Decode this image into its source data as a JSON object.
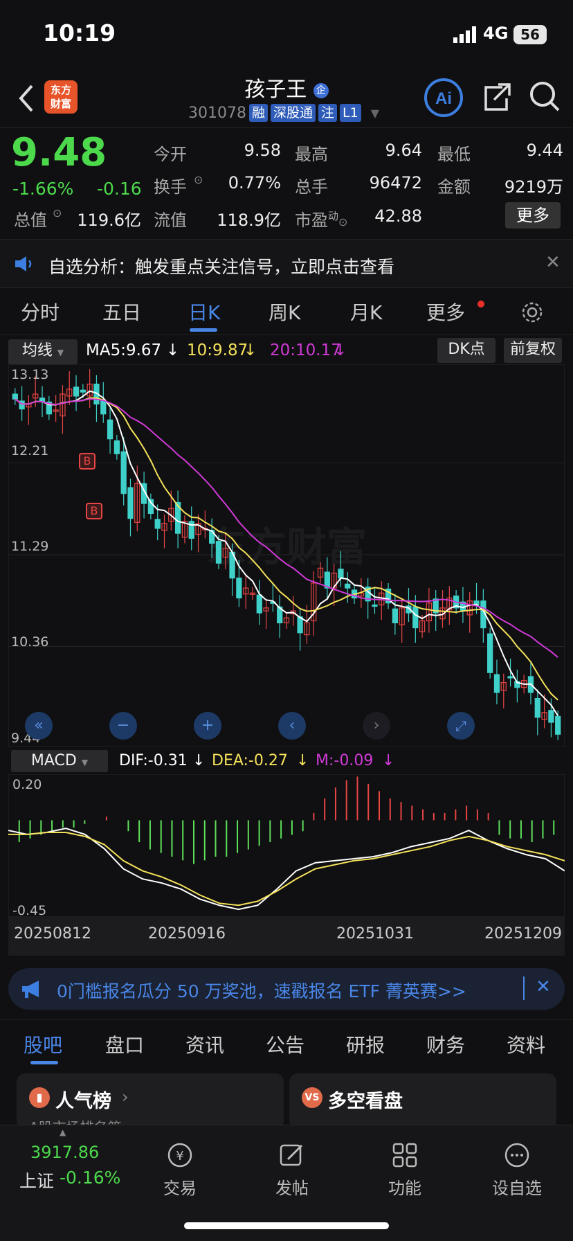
{
  "status_bar": {
    "time": "10:19",
    "network": "4G",
    "battery": "56"
  },
  "header": {
    "logo_text": "东方\n财富",
    "title": "孩子王",
    "code": "301078",
    "tags": [
      "融",
      "深股通",
      "注",
      "L1"
    ]
  },
  "quote": {
    "price": "9.48",
    "change_pct": "-1.66%",
    "change": "-0.16",
    "fields": {
      "open_label": "今开",
      "open": "9.58",
      "high_label": "最高",
      "high": "9.64",
      "low_label": "最低",
      "low": "9.44",
      "turnover_label": "换手",
      "turnover": "0.77%",
      "volume_label": "总手",
      "volume": "96472",
      "amount_label": "金额",
      "amount": "9219万",
      "mcap_label": "总值",
      "mcap": "119.6亿",
      "float_label": "流值",
      "float": "118.9亿",
      "pe_label": "市盈",
      "pe_sup": "动",
      "pe": "42.88"
    },
    "more_button": "更多"
  },
  "notice": {
    "text": "自选分析：触发重点关注信号，立即点击查看"
  },
  "period_tabs": [
    "分时",
    "五日",
    "日K",
    "周K",
    "月K",
    "更多"
  ],
  "active_period": "日K",
  "chart_toolbar": {
    "indicator": "均线",
    "ma5": "MA5:9.67",
    "ma10": "10:9.87",
    "ma20": "20:10.17",
    "dk_button": "DK点",
    "adjust_button": "前复权"
  },
  "macd_toolbar": {
    "indicator": "MACD",
    "dif": "DIF:-0.31",
    "dea": "DEA:-0.27",
    "m": "M:-0.09"
  },
  "chart_data": {
    "type": "candlestick",
    "price_ticks": [
      "13.13",
      "12.21",
      "11.29",
      "10.36",
      "9.44"
    ],
    "price_range": [
      9.44,
      13.13
    ],
    "macd_ticks": [
      "0.20",
      "-0.45"
    ],
    "macd_range": [
      -0.45,
      0.2
    ],
    "date_labels": [
      "20250812",
      "20250916",
      "20251031",
      "20251209"
    ],
    "buy_markers": [
      "B",
      "B"
    ],
    "colors": {
      "up": "#e84545",
      "down": "#3fd1c9",
      "ma5": "#ffffff",
      "ma10": "#f4e15a",
      "ma20": "#d03ad6"
    },
    "close": [
      12.85,
      12.75,
      12.8,
      12.9,
      12.82,
      12.7,
      12.74,
      12.9,
      12.95,
      12.88,
      12.92,
      13.0,
      12.8,
      12.7,
      12.45,
      12.3,
      11.9,
      11.65,
      12.0,
      11.8,
      11.7,
      11.55,
      11.6,
      11.75,
      11.5,
      11.62,
      11.45,
      11.6,
      11.55,
      11.4,
      11.2,
      11.35,
      11.05,
      10.85,
      10.95,
      10.9,
      10.7,
      10.75,
      10.8,
      10.6,
      10.65,
      10.72,
      10.5,
      10.6,
      11.0,
      11.15,
      10.95,
      11.1,
      11.05,
      10.95,
      10.85,
      10.9,
      10.82,
      10.78,
      10.9,
      10.8,
      10.6,
      10.75,
      10.7,
      10.55,
      10.62,
      10.8,
      10.7,
      10.75,
      10.85,
      10.75,
      10.72,
      10.82,
      10.78,
      10.55,
      10.1,
      9.9,
      10.0,
      10.05,
      9.95,
      10.02,
      9.9,
      9.65,
      9.7,
      9.6,
      9.48
    ],
    "macd_hist": [
      -0.06,
      -0.05,
      -0.04,
      -0.03,
      -0.02,
      -0.02,
      -0.01,
      0.0,
      0.01,
      0.0,
      -0.03,
      -0.06,
      -0.08,
      -0.09,
      -0.1,
      -0.11,
      -0.12,
      -0.11,
      -0.1,
      -0.1,
      -0.09,
      -0.08,
      -0.07,
      -0.06,
      -0.05,
      -0.04,
      -0.03,
      0.02,
      0.06,
      0.09,
      0.11,
      0.12,
      0.1,
      0.08,
      0.06,
      0.05,
      0.04,
      0.03,
      0.02,
      0.02,
      0.03,
      0.04,
      0.03,
      0.02,
      -0.04,
      -0.05,
      -0.05,
      -0.06,
      -0.05,
      -0.04
    ],
    "dif": [
      -0.05,
      -0.07,
      -0.06,
      -0.04,
      -0.07,
      -0.14,
      -0.24,
      -0.29,
      -0.31,
      -0.34,
      -0.39,
      -0.42,
      -0.44,
      -0.42,
      -0.34,
      -0.25,
      -0.21,
      -0.2,
      -0.19,
      -0.18,
      -0.16,
      -0.13,
      -0.11,
      -0.09,
      -0.05,
      -0.1,
      -0.14,
      -0.17,
      -0.19,
      -0.25
    ],
    "dea": [
      -0.07,
      -0.07,
      -0.06,
      -0.06,
      -0.08,
      -0.12,
      -0.2,
      -0.25,
      -0.28,
      -0.32,
      -0.37,
      -0.41,
      -0.42,
      -0.4,
      -0.35,
      -0.29,
      -0.24,
      -0.22,
      -0.2,
      -0.19,
      -0.17,
      -0.15,
      -0.13,
      -0.1,
      -0.08,
      -0.1,
      -0.13,
      -0.15,
      -0.17,
      -0.2
    ]
  },
  "banner": {
    "text": "0门槛报名瓜分 50 万奖池，速戳报名 ETF 菁英赛>>"
  },
  "content_tabs": [
    "股吧",
    "盘口",
    "资讯",
    "公告",
    "研报",
    "财务",
    "资料"
  ],
  "cards": {
    "left": "人气榜",
    "left_sub": "A股市场排名第",
    "right": "多空看盘"
  },
  "bottom_nav": {
    "index_value": "3917.86",
    "index_name": "上证",
    "index_change": "-0.16%",
    "items": [
      "交易",
      "发帖",
      "功能",
      "设自选"
    ]
  }
}
